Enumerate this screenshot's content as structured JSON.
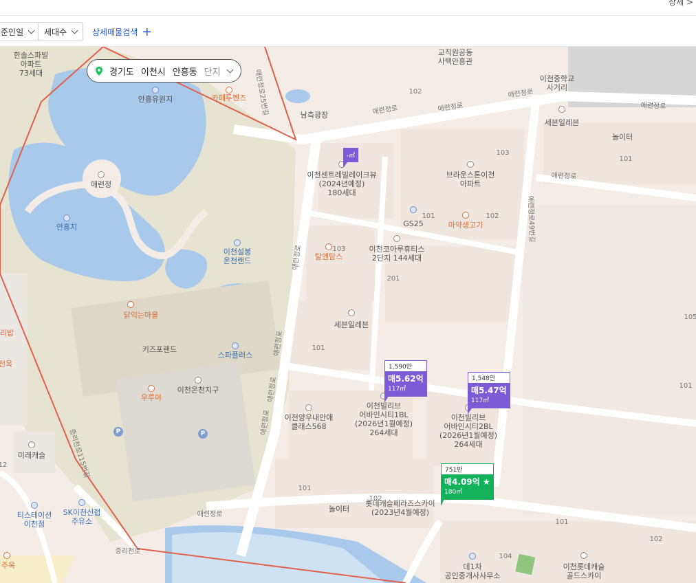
{
  "topbar": {
    "right_text": "상세 >"
  },
  "filters": {
    "date_filter": "준인일",
    "households_filter": "세대수",
    "detail_search": "상세매물검색",
    "plus": "+"
  },
  "breadcrumb": {
    "province": "경기도",
    "city": "이천시",
    "district": "안흥동",
    "level": "단지"
  },
  "map": {
    "labels": {
      "hansol": "한솔스파빌\n아파트\n73세대",
      "anheung_park": "안흥유원지",
      "cafe": "카페투헨즈",
      "aeryeonjeong": "애련정",
      "anheungji": "안흥지",
      "seolbong": "이천설봉\n온천랜드",
      "dakik": "닭익는마을",
      "kids": "키즈포랜드",
      "spaplus": "스파플러스",
      "ichon_hot_spring": "이천온천지구",
      "wuhuya": "우루야",
      "giri": "리밥",
      "jeonok": "전옥",
      "mirae": "미래캐슬",
      "tstation": "티스테이션\n이천점",
      "sk": "SK이천신협\n주유소",
      "jusok": "주옥",
      "jeonggwang": "남측광장",
      "gyojik": "교직원공동\n사택안흥관",
      "ichon_school": "이천중학교\n사거리",
      "seven1": "세븐일레븐",
      "nolter1": "놀이터",
      "central_lake": "이천센트레빌레이크뷰\n(2024년예정)\n180세대",
      "brown": "브라운스톤이천\n아파트",
      "gs25": "GS25",
      "mayak": "마약생고기",
      "taltan": "탈앤탐스",
      "korea": "이천코아루휴티스\n2단지 144세대",
      "seven2": "세븐일레븐",
      "wooan": "이천양우내안애\n클래스568",
      "billive1": "이천빌리브\n어바인시티1BL\n(2026년1월예정)\n264세대",
      "billive2": "이천빌리브\n어바인시티2BL\n(2026년1월예정)\n264세대",
      "lotte": "롯데캐슬페라즈스카이\n(2023년4월예정)",
      "nolter2": "놀이터",
      "agent": "공인중개사사무소",
      "lotte_golf": "이천롯데캐슬\n골드스카이",
      "dongsu": "데1차"
    },
    "roads": {
      "r1": "애련정로",
      "r2": "애련정로",
      "r3": "애련정로",
      "r4": "애련정로",
      "r5": "애련정로",
      "r6": "애련정로",
      "r7": "애련정로",
      "r8": "애련정로",
      "r9": "애련정로",
      "r10": "애련정로",
      "r11": "애련정로25번길",
      "r12": "애련정로49번길",
      "r13": "중리천로",
      "r14": "중리천로115번길"
    },
    "numbers": [
      "102",
      "103",
      "101",
      "102",
      "201",
      "103",
      "101",
      "101",
      "102",
      "101",
      "104",
      "102",
      "105",
      "101",
      "12",
      "101"
    ]
  },
  "markers": [
    {
      "top": "1,590만",
      "price": "매5.62억",
      "area": "117㎡"
    },
    {
      "top": "1,548만",
      "price": "매5.47억",
      "area": "117㎡"
    },
    {
      "top": "751만",
      "price": "매4.09억 ★",
      "area": "180㎡"
    }
  ],
  "small_marker": "-㎡",
  "colors": {
    "purple": "#7b5bd6",
    "green": "#11b25a",
    "boundary": "#e2604a",
    "water": "#a8c9ea"
  }
}
